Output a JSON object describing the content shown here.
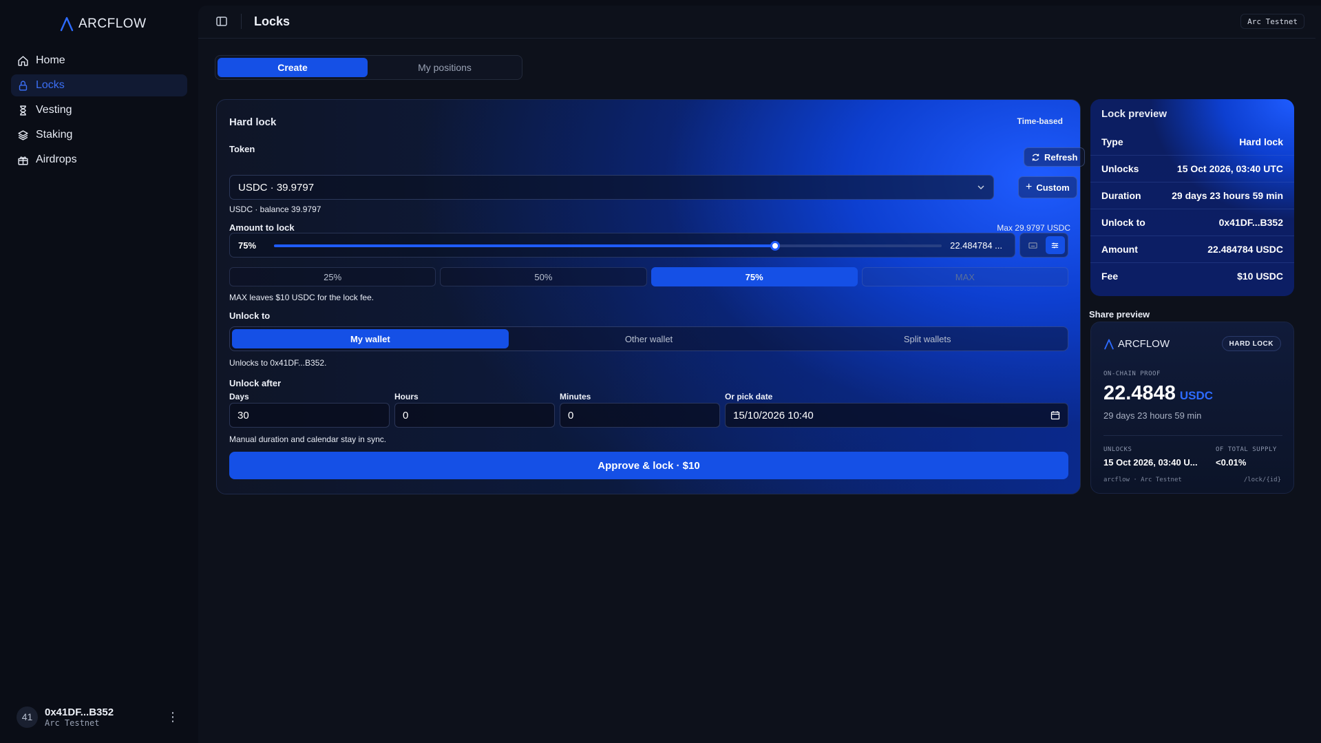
{
  "app": {
    "name": "ARCFLOW",
    "network": "Arc Testnet"
  },
  "sidebar": {
    "items": [
      {
        "label": "Home",
        "icon": "home-icon"
      },
      {
        "label": "Locks",
        "icon": "lock-icon",
        "active": true
      },
      {
        "label": "Vesting",
        "icon": "hourglass-icon"
      },
      {
        "label": "Staking",
        "icon": "layers-icon"
      },
      {
        "label": "Airdrops",
        "icon": "gift-icon"
      }
    ],
    "user": {
      "avatar": "41",
      "address": "0x41DF...B352",
      "network": "Arc Testnet"
    }
  },
  "header": {
    "title": "Locks",
    "network_badge": "Arc Testnet"
  },
  "tabs": [
    {
      "label": "Create",
      "active": true
    },
    {
      "label": "My positions"
    }
  ],
  "form": {
    "title": "Hard lock",
    "tag": "Time-based",
    "token_label": "Token",
    "refresh_label": "Refresh",
    "custom_label": "Custom",
    "token_value": "USDC · 39.9797",
    "token_balance": "USDC · balance 39.9797",
    "amount_label": "Amount to lock",
    "amount_max": "Max 29.9797 USDC",
    "amount_percent": "75%",
    "amount_fraction": 0.75,
    "amount_value": "22.484784 ...",
    "percent_options": [
      "25%",
      "50%",
      "75%",
      "MAX"
    ],
    "max_hint": "MAX leaves $10 USDC for the lock fee.",
    "unlock_to_label": "Unlock to",
    "unlock_options": [
      "My wallet",
      "Other wallet",
      "Split wallets"
    ],
    "unlock_hint": "Unlocks to 0x41DF...B352.",
    "unlock_after_label": "Unlock after",
    "days_label": "Days",
    "days_value": "30",
    "hours_label": "Hours",
    "hours_value": "0",
    "minutes_label": "Minutes",
    "minutes_value": "0",
    "date_label": "Or pick date",
    "date_value": "15/10/2026 10:40",
    "sync_hint": "Manual duration and calendar stay in sync.",
    "submit_label": "Approve & lock · $10"
  },
  "preview": {
    "title": "Lock preview",
    "rows": [
      {
        "key": "Type",
        "value": "Hard lock"
      },
      {
        "key": "Unlocks",
        "value": "15 Oct 2026, 03:40 UTC"
      },
      {
        "key": "Duration",
        "value": "29 days 23 hours 59 min"
      },
      {
        "key": "Unlock to",
        "value": "0x41DF...B352"
      },
      {
        "key": "Amount",
        "value": "22.484784 USDC"
      },
      {
        "key": "Fee",
        "value": "$10 USDC"
      }
    ]
  },
  "share": {
    "label": "Share preview",
    "brand": "ARCFLOW",
    "badge": "HARD LOCK",
    "proof_label": "ON-CHAIN PROOF",
    "amount": "22.4848",
    "unit": "USDC",
    "duration": "29 days 23 hours 59 min",
    "unlocks_label": "UNLOCKS",
    "unlocks_value": "15 Oct 2026, 03:40 U...",
    "supply_label": "OF TOTAL SUPPLY",
    "supply_value": "<0.01%",
    "footer_left": "arcflow · Arc Testnet",
    "footer_right": "/lock/{id}"
  },
  "colors": {
    "accent": "#1550e6",
    "background": "#0a0d16"
  }
}
